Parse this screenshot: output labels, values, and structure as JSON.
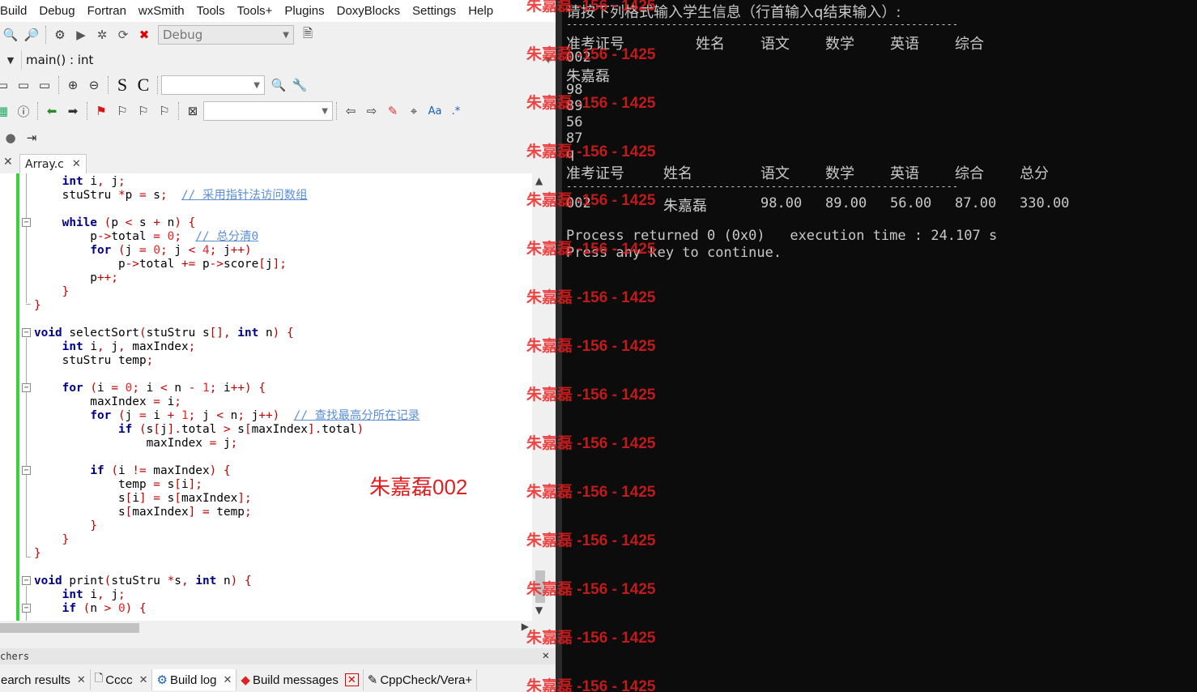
{
  "menu": [
    "Build",
    "Debug",
    "Fortran",
    "wxSmith",
    "Tools",
    "Tools+",
    "Plugins",
    "DoxyBlocks",
    "Settings",
    "Help"
  ],
  "toolbar": {
    "build_target": "Debug",
    "scope_value": "main() : int",
    "style_buttons": [
      "S",
      "C"
    ]
  },
  "editor": {
    "tab_label": "Array.c",
    "overlay_text": "朱嘉磊002"
  },
  "bottom_panel": {
    "title": "chers",
    "tabs": [
      {
        "label": "earch results"
      },
      {
        "label": "Cccc"
      },
      {
        "label": "Build log"
      },
      {
        "label": "Build messages"
      },
      {
        "label": "CppCheck/Vera+"
      }
    ]
  },
  "console": {
    "prompt": "请按下列格式输入学生信息（行首输入q结束输入）:",
    "dashes": "-------------------------------------------------------------------",
    "header1": [
      "准考证号",
      "姓名",
      "语文",
      "数学",
      "英语",
      "综合"
    ],
    "inputs": [
      "002",
      "朱嘉磊",
      "98",
      "89",
      "56",
      "87",
      "q"
    ],
    "header2": [
      "准考证号",
      "姓名",
      "语文",
      "数学",
      "英语",
      "综合",
      "总分"
    ],
    "row": [
      "002",
      "朱嘉磊",
      "98.00",
      "89.00",
      "56.00",
      "87.00",
      "330.00"
    ],
    "process_line": "Process returned 0 (0x0)   execution time : 24.107 s",
    "continue_line": "Press any key to continue."
  },
  "watermark": "朱嘉磊 -156 - 1425"
}
